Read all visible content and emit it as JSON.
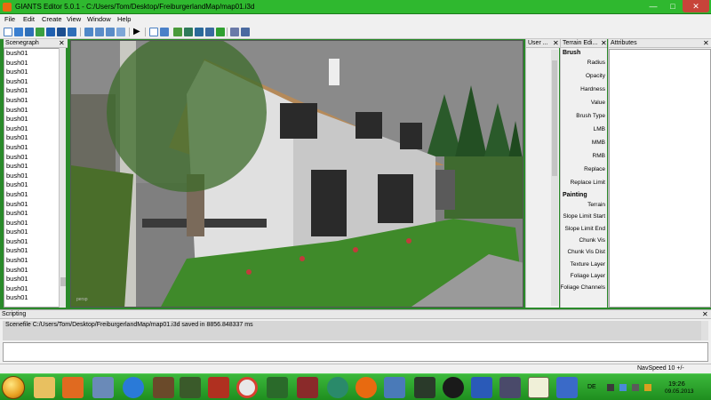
{
  "window": {
    "title": "GIANTS Editor 5.0.1 - C:/Users/Tom/Desktop/FreiburgerlandMap/map01.i3d",
    "min_glyph": "—",
    "max_glyph": "□",
    "close_glyph": "✕"
  },
  "menu": [
    "File",
    "Edit",
    "Create",
    "View",
    "Window",
    "Help"
  ],
  "scenegraph": {
    "title": "Scenegraph",
    "close_glyph": "✕",
    "items": [
      "bush01",
      "bush01",
      "bush01",
      "bush01",
      "bush01",
      "bush01",
      "bush01",
      "bush01",
      "bush01",
      "bush01",
      "bush01",
      "bush01",
      "bush01",
      "bush01",
      "bush01",
      "bush01",
      "bush01",
      "bush01",
      "bush01",
      "bush01",
      "bush01",
      "bush01",
      "bush01",
      "bush01",
      "bush01",
      "bush01",
      "bush01"
    ]
  },
  "viewport": {
    "camera_label": "persp"
  },
  "user_panel": {
    "title": "User ...",
    "close_glyph": "✕"
  },
  "terrain": {
    "title": "Terrain Edi...",
    "close_glyph": "✕",
    "brush_header": "Brush",
    "brush_props": [
      "Radius",
      "Opacity",
      "Hardness",
      "Value",
      "Brush Type",
      "LMB",
      "MMB",
      "RMB",
      "Replace",
      "Replace Limit"
    ],
    "painting_header": "Painting",
    "painting_props": [
      "Terrain",
      "Slope Limit Start",
      "Slope Limit End",
      "Chunk Vis",
      "Chunk Vis Dist",
      "Texture Layer",
      "Foliage Layer",
      "Foliage Channels"
    ]
  },
  "attributes": {
    "title": "Attributes",
    "close_glyph": "✕"
  },
  "scripting": {
    "title": "Scripting",
    "close_glyph": "✕",
    "log": "Scenefile C:/Users/Tom/Desktop/FreiburgerlandMap/map01.i3d saved in 8856.848337 ms"
  },
  "status": {
    "nav_speed": "NavSpeed 10 +/-"
  },
  "taskbar": {
    "language": "DE",
    "time": "19:26",
    "date": "09.05.2013"
  }
}
